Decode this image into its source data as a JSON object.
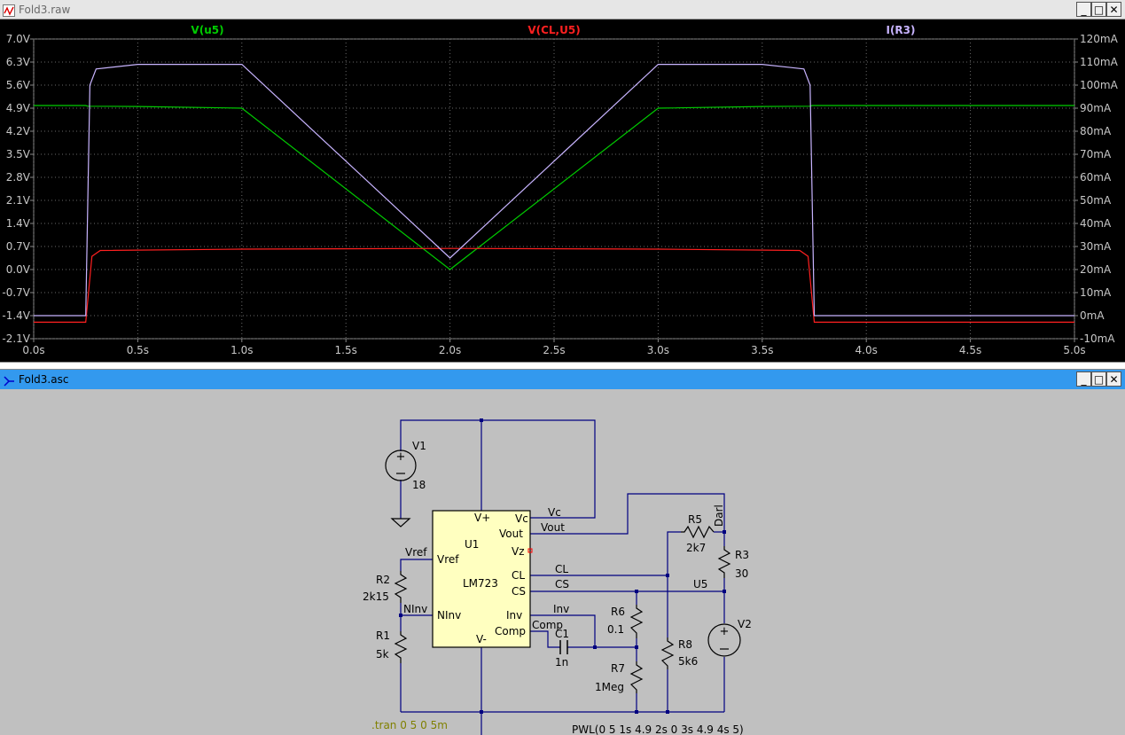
{
  "waveform_window": {
    "title": "Fold3.raw",
    "buttons": {
      "minimize": "_",
      "maximize": "□",
      "close": "✕"
    },
    "icon": "waveform-icon"
  },
  "schematic_window": {
    "title": "Fold3.asc",
    "buttons": {
      "minimize": "_",
      "maximize": "□",
      "close": "✕"
    },
    "icon": "schematic-icon"
  },
  "chart_data": {
    "type": "line",
    "series": [
      {
        "name": "V(u5)",
        "color": "#00cc00",
        "axis": "left",
        "x": [
          0,
          0.25,
          0.26,
          0.5,
          1.0,
          2.0,
          3.0,
          3.5,
          3.73,
          3.74,
          5.0
        ],
        "y": [
          4.98,
          4.98,
          4.96,
          4.95,
          4.9,
          0.0,
          4.9,
          4.95,
          4.96,
          4.98,
          4.98
        ]
      },
      {
        "name": "V(CL,U5)",
        "color": "#ff2020",
        "axis": "left",
        "x": [
          0,
          0.25,
          0.28,
          0.32,
          1.0,
          2.0,
          3.0,
          3.68,
          3.72,
          3.75,
          5.0
        ],
        "y": [
          -1.6,
          -1.6,
          0.4,
          0.58,
          0.62,
          0.64,
          0.62,
          0.58,
          0.4,
          -1.6,
          -1.6
        ]
      },
      {
        "name": "I(R3)",
        "color": "#c8b4ff",
        "axis": "right",
        "x": [
          0,
          0.25,
          0.27,
          0.3,
          0.5,
          1.0,
          2.0,
          3.0,
          3.5,
          3.7,
          3.73,
          3.75,
          5.0
        ],
        "y": [
          0,
          0,
          100,
          107,
          109,
          109,
          25,
          109,
          109,
          107,
          100,
          0,
          0
        ]
      }
    ],
    "x_ticks": [
      "0.0s",
      "0.5s",
      "1.0s",
      "1.5s",
      "2.0s",
      "2.5s",
      "3.0s",
      "3.5s",
      "4.0s",
      "4.5s",
      "5.0s"
    ],
    "left_ticks": [
      "7.0V",
      "6.3V",
      "5.6V",
      "4.9V",
      "4.2V",
      "3.5V",
      "2.8V",
      "2.1V",
      "1.4V",
      "0.7V",
      "0.0V",
      "-0.7V",
      "-1.4V",
      "-2.1V"
    ],
    "right_ticks": [
      "120mA",
      "110mA",
      "100mA",
      "90mA",
      "80mA",
      "70mA",
      "60mA",
      "50mA",
      "40mA",
      "30mA",
      "20mA",
      "10mA",
      "0mA",
      "-10mA"
    ],
    "xlim": [
      0,
      5
    ],
    "ylim_left": [
      -2.1,
      7.0
    ],
    "ylim_right": [
      -10,
      120
    ],
    "grid": true
  },
  "schematic": {
    "labels": {
      "V1": "V1",
      "V1_value": "18",
      "U1": "U1",
      "U1_part": "LM723",
      "pin_vplus": "V+",
      "pin_vc": "Vc",
      "pin_vout": "Vout",
      "pin_vz": "Vz",
      "pin_vref": "Vref",
      "pin_cl": "CL",
      "pin_cs": "CS",
      "pin_ninv": "NInv",
      "pin_inv": "Inv",
      "pin_comp": "Comp",
      "pin_vminus": "V-",
      "net_vc": "Vc",
      "net_vout": "Vout",
      "net_vref": "Vref",
      "net_cl": "CL",
      "net_cs": "CS",
      "net_ninv": "NInv",
      "net_inv": "Inv",
      "net_comp": "Comp",
      "net_u5": "U5",
      "net_darl": "Darl",
      "R1": "R1",
      "R1_value": "5k",
      "R2": "R2",
      "R2_value": "2k15",
      "R3": "R3",
      "R3_value": "30",
      "R5": "R5",
      "R5_value": "2k7",
      "R6": "R6",
      "R6_value": "0.1",
      "R7": "R7",
      "R7_value": "1Meg",
      "R8": "R8",
      "R8_value": "5k6",
      "C1": "C1",
      "C1_value": "1n",
      "V2": "V2",
      "V2_value": "PWL(0 5 1s 4.9 2s 0 3s 4.9 4s 5)",
      "directive": ".tran 0 5 0 5m"
    },
    "colors": {
      "wire": "#000080",
      "component": "#000000",
      "ic_fill": "#ffffc0",
      "directive": "#808000",
      "background": "#c0c0c0"
    }
  }
}
